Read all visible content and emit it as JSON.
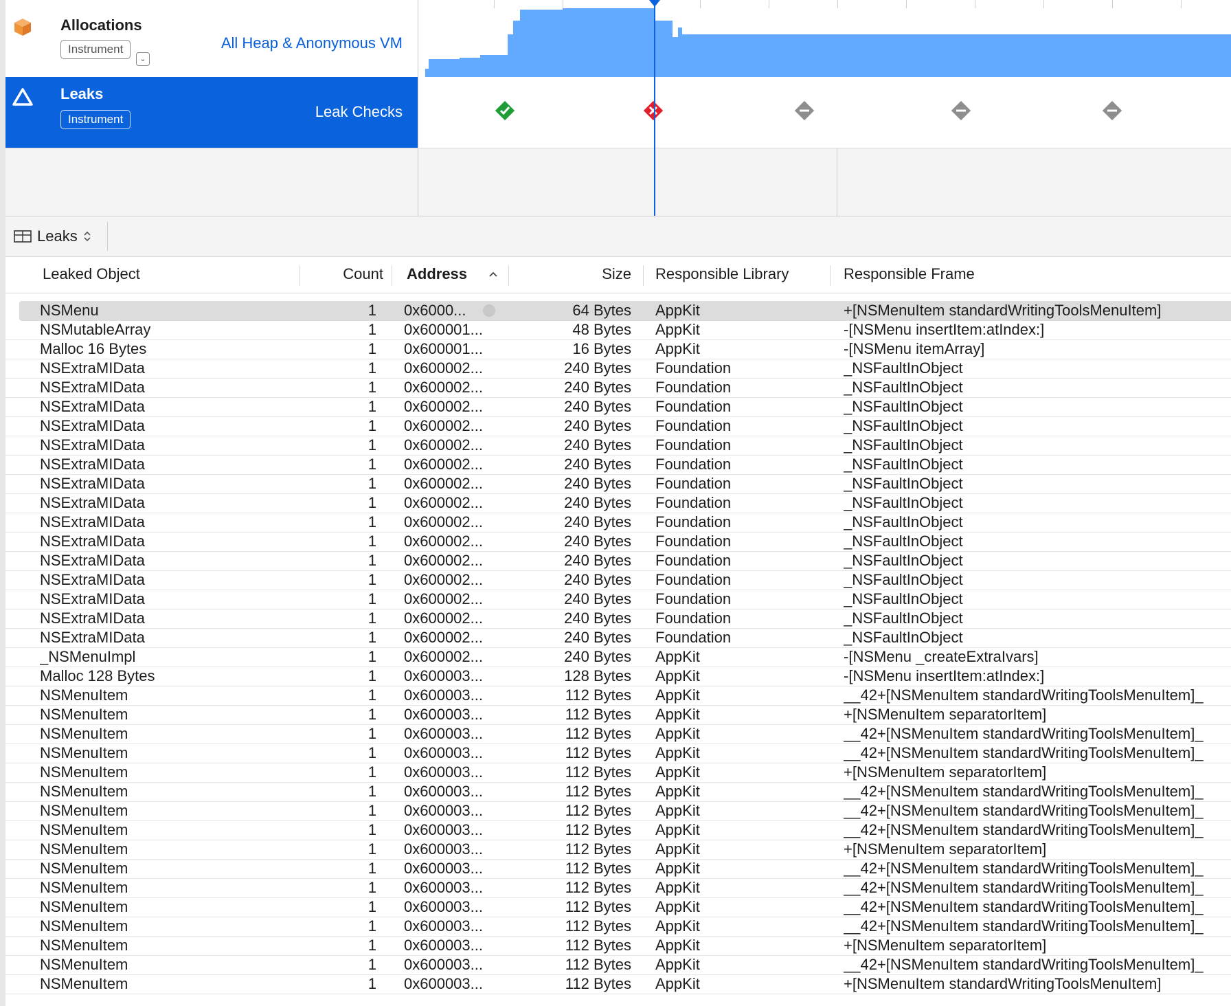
{
  "tracks": {
    "allocations": {
      "name": "Allocations",
      "badge": "Instrument",
      "detail": "All Heap & Anonymous VM",
      "icon": "allocations-cube-icon",
      "color": "#f0943a"
    },
    "leaks": {
      "name": "Leaks",
      "badge": "Instrument",
      "detail": "Leak Checks",
      "icon": "leaks-warning-icon",
      "selected_color": "#0a63dd",
      "checks": [
        "passed",
        "failed",
        "pending",
        "pending",
        "pending"
      ]
    }
  },
  "detail": {
    "selector_label": "Leaks"
  },
  "table": {
    "columns": {
      "leaked_object": "Leaked Object",
      "count": "Count",
      "address": "Address",
      "size": "Size",
      "library": "Responsible Library",
      "frame": "Responsible Frame"
    },
    "sorted_by": "Address",
    "rows": [
      {
        "obj": "NSMenu",
        "count": "1",
        "addr": "0x6000...",
        "size": "64 Bytes",
        "lib": "AppKit",
        "frame": "+[NSMenuItem standardWritingToolsMenuItem]"
      },
      {
        "obj": "NSMutableArray",
        "count": "1",
        "addr": "0x600001...",
        "size": "48 Bytes",
        "lib": "AppKit",
        "frame": "-[NSMenu insertItem:atIndex:]"
      },
      {
        "obj": "Malloc 16 Bytes",
        "count": "1",
        "addr": "0x600001...",
        "size": "16 Bytes",
        "lib": "AppKit",
        "frame": "-[NSMenu itemArray]"
      },
      {
        "obj": "NSExtraMIData",
        "count": "1",
        "addr": "0x600002...",
        "size": "240 Bytes",
        "lib": "Foundation",
        "frame": "_NSFaultInObject"
      },
      {
        "obj": "NSExtraMIData",
        "count": "1",
        "addr": "0x600002...",
        "size": "240 Bytes",
        "lib": "Foundation",
        "frame": "_NSFaultInObject"
      },
      {
        "obj": "NSExtraMIData",
        "count": "1",
        "addr": "0x600002...",
        "size": "240 Bytes",
        "lib": "Foundation",
        "frame": "_NSFaultInObject"
      },
      {
        "obj": "NSExtraMIData",
        "count": "1",
        "addr": "0x600002...",
        "size": "240 Bytes",
        "lib": "Foundation",
        "frame": "_NSFaultInObject"
      },
      {
        "obj": "NSExtraMIData",
        "count": "1",
        "addr": "0x600002...",
        "size": "240 Bytes",
        "lib": "Foundation",
        "frame": "_NSFaultInObject"
      },
      {
        "obj": "NSExtraMIData",
        "count": "1",
        "addr": "0x600002...",
        "size": "240 Bytes",
        "lib": "Foundation",
        "frame": "_NSFaultInObject"
      },
      {
        "obj": "NSExtraMIData",
        "count": "1",
        "addr": "0x600002...",
        "size": "240 Bytes",
        "lib": "Foundation",
        "frame": "_NSFaultInObject"
      },
      {
        "obj": "NSExtraMIData",
        "count": "1",
        "addr": "0x600002...",
        "size": "240 Bytes",
        "lib": "Foundation",
        "frame": "_NSFaultInObject"
      },
      {
        "obj": "NSExtraMIData",
        "count": "1",
        "addr": "0x600002...",
        "size": "240 Bytes",
        "lib": "Foundation",
        "frame": "_NSFaultInObject"
      },
      {
        "obj": "NSExtraMIData",
        "count": "1",
        "addr": "0x600002...",
        "size": "240 Bytes",
        "lib": "Foundation",
        "frame": "_NSFaultInObject"
      },
      {
        "obj": "NSExtraMIData",
        "count": "1",
        "addr": "0x600002...",
        "size": "240 Bytes",
        "lib": "Foundation",
        "frame": "_NSFaultInObject"
      },
      {
        "obj": "NSExtraMIData",
        "count": "1",
        "addr": "0x600002...",
        "size": "240 Bytes",
        "lib": "Foundation",
        "frame": "_NSFaultInObject"
      },
      {
        "obj": "NSExtraMIData",
        "count": "1",
        "addr": "0x600002...",
        "size": "240 Bytes",
        "lib": "Foundation",
        "frame": "_NSFaultInObject"
      },
      {
        "obj": "NSExtraMIData",
        "count": "1",
        "addr": "0x600002...",
        "size": "240 Bytes",
        "lib": "Foundation",
        "frame": "_NSFaultInObject"
      },
      {
        "obj": "NSExtraMIData",
        "count": "1",
        "addr": "0x600002...",
        "size": "240 Bytes",
        "lib": "Foundation",
        "frame": "_NSFaultInObject"
      },
      {
        "obj": "_NSMenuImpl",
        "count": "1",
        "addr": "0x600002...",
        "size": "240 Bytes",
        "lib": "AppKit",
        "frame": "-[NSMenu _createExtraIvars]"
      },
      {
        "obj": "Malloc 128 Bytes",
        "count": "1",
        "addr": "0x600003...",
        "size": "128 Bytes",
        "lib": "AppKit",
        "frame": "-[NSMenu insertItem:atIndex:]"
      },
      {
        "obj": "NSMenuItem",
        "count": "1",
        "addr": "0x600003...",
        "size": "112 Bytes",
        "lib": "AppKit",
        "frame": "__42+[NSMenuItem standardWritingToolsMenuItem]_"
      },
      {
        "obj": "NSMenuItem",
        "count": "1",
        "addr": "0x600003...",
        "size": "112 Bytes",
        "lib": "AppKit",
        "frame": "+[NSMenuItem separatorItem]"
      },
      {
        "obj": "NSMenuItem",
        "count": "1",
        "addr": "0x600003...",
        "size": "112 Bytes",
        "lib": "AppKit",
        "frame": "__42+[NSMenuItem standardWritingToolsMenuItem]_"
      },
      {
        "obj": "NSMenuItem",
        "count": "1",
        "addr": "0x600003...",
        "size": "112 Bytes",
        "lib": "AppKit",
        "frame": "__42+[NSMenuItem standardWritingToolsMenuItem]_"
      },
      {
        "obj": "NSMenuItem",
        "count": "1",
        "addr": "0x600003...",
        "size": "112 Bytes",
        "lib": "AppKit",
        "frame": "+[NSMenuItem separatorItem]"
      },
      {
        "obj": "NSMenuItem",
        "count": "1",
        "addr": "0x600003...",
        "size": "112 Bytes",
        "lib": "AppKit",
        "frame": "__42+[NSMenuItem standardWritingToolsMenuItem]_"
      },
      {
        "obj": "NSMenuItem",
        "count": "1",
        "addr": "0x600003...",
        "size": "112 Bytes",
        "lib": "AppKit",
        "frame": "__42+[NSMenuItem standardWritingToolsMenuItem]_"
      },
      {
        "obj": "NSMenuItem",
        "count": "1",
        "addr": "0x600003...",
        "size": "112 Bytes",
        "lib": "AppKit",
        "frame": "__42+[NSMenuItem standardWritingToolsMenuItem]_"
      },
      {
        "obj": "NSMenuItem",
        "count": "1",
        "addr": "0x600003...",
        "size": "112 Bytes",
        "lib": "AppKit",
        "frame": "+[NSMenuItem separatorItem]"
      },
      {
        "obj": "NSMenuItem",
        "count": "1",
        "addr": "0x600003...",
        "size": "112 Bytes",
        "lib": "AppKit",
        "frame": "__42+[NSMenuItem standardWritingToolsMenuItem]_"
      },
      {
        "obj": "NSMenuItem",
        "count": "1",
        "addr": "0x600003...",
        "size": "112 Bytes",
        "lib": "AppKit",
        "frame": "__42+[NSMenuItem standardWritingToolsMenuItem]_"
      },
      {
        "obj": "NSMenuItem",
        "count": "1",
        "addr": "0x600003...",
        "size": "112 Bytes",
        "lib": "AppKit",
        "frame": "__42+[NSMenuItem standardWritingToolsMenuItem]_"
      },
      {
        "obj": "NSMenuItem",
        "count": "1",
        "addr": "0x600003...",
        "size": "112 Bytes",
        "lib": "AppKit",
        "frame": "__42+[NSMenuItem standardWritingToolsMenuItem]_"
      },
      {
        "obj": "NSMenuItem",
        "count": "1",
        "addr": "0x600003...",
        "size": "112 Bytes",
        "lib": "AppKit",
        "frame": "+[NSMenuItem separatorItem]"
      },
      {
        "obj": "NSMenuItem",
        "count": "1",
        "addr": "0x600003...",
        "size": "112 Bytes",
        "lib": "AppKit",
        "frame": "__42+[NSMenuItem standardWritingToolsMenuItem]_"
      },
      {
        "obj": "NSMenuItem",
        "count": "1",
        "addr": "0x600003...",
        "size": "112 Bytes",
        "lib": "AppKit",
        "frame": "+[NSMenuItem standardWritingToolsMenuItem]"
      }
    ]
  }
}
